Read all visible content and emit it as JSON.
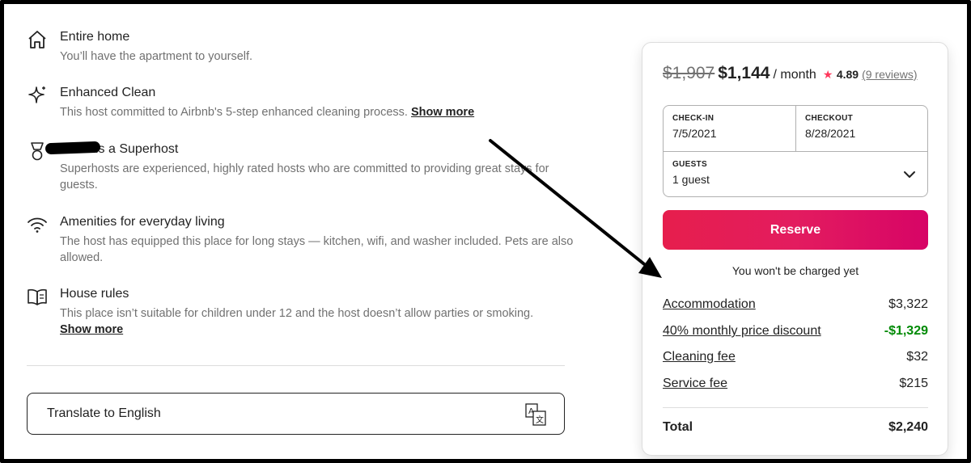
{
  "features": [
    {
      "title": "Entire home",
      "desc": "You’ll have the apartment to yourself.",
      "icon": "house-icon"
    },
    {
      "title": "Enhanced Clean",
      "desc": "This host committed to Airbnb's 5-step enhanced cleaning process.",
      "link": "Show more",
      "icon": "sparkle-icon"
    },
    {
      "title": "is a Superhost",
      "desc": "Superhosts are experienced, highly rated hosts who are committed to providing great stays for guests.",
      "icon": "superhost-medal-icon"
    },
    {
      "title": "Amenities for everyday living",
      "desc": "The host has equipped this place for long stays — kitchen, wifi, and washer included. Pets are also allowed.",
      "icon": "wifi-icon"
    },
    {
      "title": "House rules",
      "desc": "This place isn’t suitable for children under 12 and the host doesn’t allow parties or smoking.",
      "link": "Show more",
      "icon": "book-icon"
    }
  ],
  "translate": {
    "label": "Translate to English",
    "icon": "translate-icon"
  },
  "booking": {
    "old_price": "$1,907",
    "price": "$1,144",
    "per": "/ month",
    "rating": "4.89",
    "reviews": "(9 reviews)",
    "checkin_label": "CHECK-IN",
    "checkin_value": "7/5/2021",
    "checkout_label": "CHECKOUT",
    "checkout_value": "8/28/2021",
    "guests_label": "GUESTS",
    "guests_value": "1 guest",
    "reserve_label": "Reserve",
    "no_charge": "You won't be charged yet",
    "fees": [
      {
        "name": "Accommodation",
        "amount": "$3,322"
      },
      {
        "name": "40% monthly price discount",
        "amount": "-$1,329"
      },
      {
        "name": "Cleaning fee",
        "amount": "$32"
      },
      {
        "name": "Service fee",
        "amount": "$215"
      }
    ],
    "total_label": "Total",
    "total_amount": "$2,240"
  },
  "colors": {
    "brand": "#E31C5F",
    "discount": "#008A05",
    "star": "#FF385C"
  }
}
